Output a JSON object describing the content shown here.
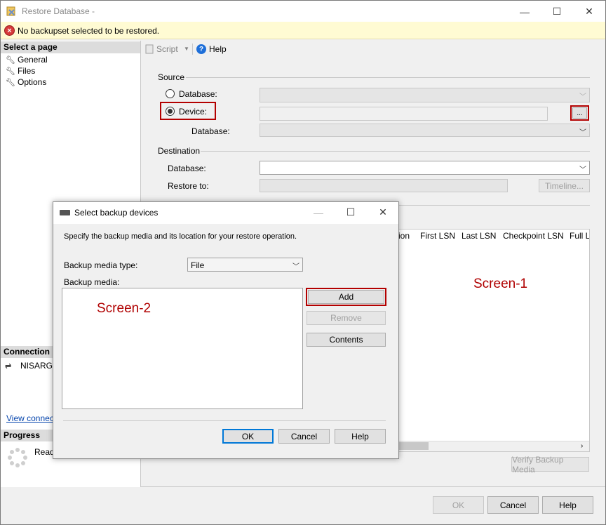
{
  "window": {
    "title": "Restore Database -"
  },
  "infobar": {
    "message": "No backupset selected to be restored."
  },
  "left_pane": {
    "select_page": "Select a page",
    "pages": [
      {
        "label": "General"
      },
      {
        "label": "Files"
      },
      {
        "label": "Options"
      }
    ],
    "connection_header": "Connection",
    "connection_name": "NISARG-I",
    "view_connection": "View connecti",
    "progress_header": "Progress",
    "progress_status": "Read"
  },
  "toolbar": {
    "script_label": "Script",
    "help_label": "Help"
  },
  "source": {
    "group_label": "Source",
    "database_radio": "Database:",
    "device_radio": "Device:",
    "browse_label": "...",
    "device_database_label": "Database:"
  },
  "destination": {
    "group_label": "Destination",
    "database_label": "Database:",
    "restore_to_label": "Restore to:",
    "timeline_label": "Timeline..."
  },
  "grid": {
    "columns": [
      "ion",
      "First LSN",
      "Last LSN",
      "Checkpoint LSN",
      "Full LS"
    ]
  },
  "verify_label": "Verify Backup Media",
  "footer": {
    "ok": "OK",
    "cancel": "Cancel",
    "help": "Help"
  },
  "annotations": {
    "screen1": "Screen-1",
    "screen2": "Screen-2"
  },
  "dialog": {
    "title": "Select backup devices",
    "description": "Specify the backup media and its location for your restore operation.",
    "media_type_label": "Backup media type:",
    "media_type_value": "File",
    "media_label": "Backup media:",
    "add": "Add",
    "remove": "Remove",
    "contents": "Contents",
    "ok": "OK",
    "cancel": "Cancel",
    "help": "Help"
  },
  "colors": {
    "highlight_red": "#b30000",
    "infobar_bg": "#fffbd3",
    "link": "#0645ad"
  }
}
